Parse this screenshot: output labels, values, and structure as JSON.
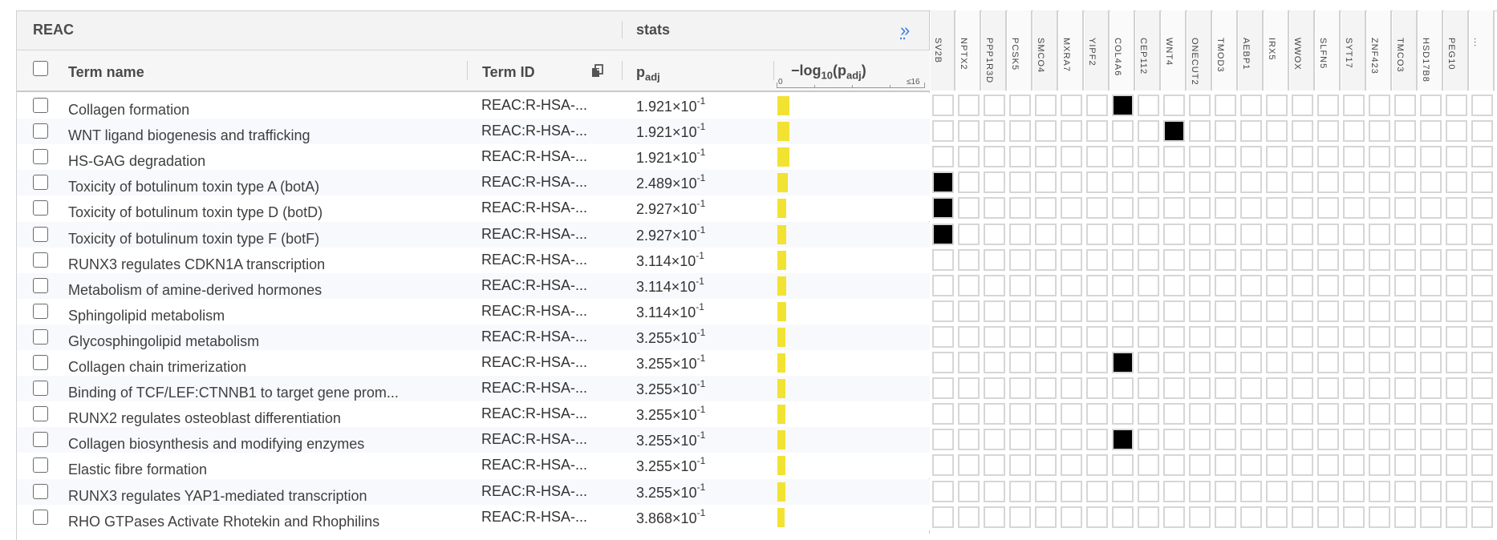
{
  "source": "REAC",
  "stats_label": "stats",
  "expand_glyph": "»",
  "columns": {
    "term_name": "Term name",
    "term_id": "Term ID",
    "padj_main": "p",
    "padj_sub": "adj",
    "log_prefix": "−log",
    "log_sub": "10",
    "log_suffix": "(p",
    "log_suffix_sub": "adj",
    "log_close": ")",
    "scale_min": "0",
    "scale_max": "≤16"
  },
  "genes": [
    "SV2B",
    "NPTX2",
    "PPP1R3D",
    "PCSK5",
    "SMCO4",
    "MXRA7",
    "YIPF2",
    "COL4A6",
    "CEP112",
    "WNT4",
    "ONECUT2",
    "TMOD3",
    "AEBP1",
    "IRX5",
    "WWOX",
    "SLFN5",
    "SYT17",
    "ZNF423",
    "TMCO3",
    "HSD17B8",
    "PEG10",
    "..."
  ],
  "rows": [
    {
      "name": "Collagen formation",
      "id": "REAC:R-HSA-...",
      "p_mant": "1.921×10",
      "p_exp": "-1",
      "neglog10": 0.716,
      "hits": [
        7
      ]
    },
    {
      "name": "WNT ligand biogenesis and trafficking",
      "id": "REAC:R-HSA-...",
      "p_mant": "1.921×10",
      "p_exp": "-1",
      "neglog10": 0.716,
      "hits": [
        9
      ]
    },
    {
      "name": "HS-GAG degradation",
      "id": "REAC:R-HSA-...",
      "p_mant": "1.921×10",
      "p_exp": "-1",
      "neglog10": 0.716,
      "hits": []
    },
    {
      "name": "Toxicity of botulinum toxin type A (botA)",
      "id": "REAC:R-HSA-...",
      "p_mant": "2.489×10",
      "p_exp": "-1",
      "neglog10": 0.604,
      "hits": [
        0
      ]
    },
    {
      "name": "Toxicity of botulinum toxin type D (botD)",
      "id": "REAC:R-HSA-...",
      "p_mant": "2.927×10",
      "p_exp": "-1",
      "neglog10": 0.534,
      "hits": [
        0
      ]
    },
    {
      "name": "Toxicity of botulinum toxin type F (botF)",
      "id": "REAC:R-HSA-...",
      "p_mant": "2.927×10",
      "p_exp": "-1",
      "neglog10": 0.534,
      "hits": [
        0
      ]
    },
    {
      "name": "RUNX3 regulates CDKN1A transcription",
      "id": "REAC:R-HSA-...",
      "p_mant": "3.114×10",
      "p_exp": "-1",
      "neglog10": 0.507,
      "hits": []
    },
    {
      "name": "Metabolism of amine-derived hormones",
      "id": "REAC:R-HSA-...",
      "p_mant": "3.114×10",
      "p_exp": "-1",
      "neglog10": 0.507,
      "hits": []
    },
    {
      "name": "Sphingolipid metabolism",
      "id": "REAC:R-HSA-...",
      "p_mant": "3.114×10",
      "p_exp": "-1",
      "neglog10": 0.507,
      "hits": []
    },
    {
      "name": "Glycosphingolipid metabolism",
      "id": "REAC:R-HSA-...",
      "p_mant": "3.255×10",
      "p_exp": "-1",
      "neglog10": 0.487,
      "hits": []
    },
    {
      "name": "Collagen chain trimerization",
      "id": "REAC:R-HSA-...",
      "p_mant": "3.255×10",
      "p_exp": "-1",
      "neglog10": 0.487,
      "hits": [
        7
      ]
    },
    {
      "name": "Binding of TCF/LEF:CTNNB1 to target gene prom...",
      "id": "REAC:R-HSA-...",
      "p_mant": "3.255×10",
      "p_exp": "-1",
      "neglog10": 0.487,
      "hits": []
    },
    {
      "name": "RUNX2 regulates osteoblast differentiation",
      "id": "REAC:R-HSA-...",
      "p_mant": "3.255×10",
      "p_exp": "-1",
      "neglog10": 0.487,
      "hits": []
    },
    {
      "name": "Collagen biosynthesis and modifying enzymes",
      "id": "REAC:R-HSA-...",
      "p_mant": "3.255×10",
      "p_exp": "-1",
      "neglog10": 0.487,
      "hits": [
        7
      ]
    },
    {
      "name": "Elastic fibre formation",
      "id": "REAC:R-HSA-...",
      "p_mant": "3.255×10",
      "p_exp": "-1",
      "neglog10": 0.487,
      "hits": []
    },
    {
      "name": "RUNX3 regulates YAP1-mediated transcription",
      "id": "REAC:R-HSA-...",
      "p_mant": "3.255×10",
      "p_exp": "-1",
      "neglog10": 0.487,
      "hits": []
    },
    {
      "name": "RHO GTPases Activate Rhotekin and Rhophilins",
      "id": "REAC:R-HSA-...",
      "p_mant": "3.868×10",
      "p_exp": "-1",
      "neglog10": 0.412,
      "hits": []
    }
  ],
  "colors": {
    "bar": "#f2e232",
    "hit": "#000000",
    "grid": "#d6d6d6",
    "accent": "#3b7de0"
  }
}
